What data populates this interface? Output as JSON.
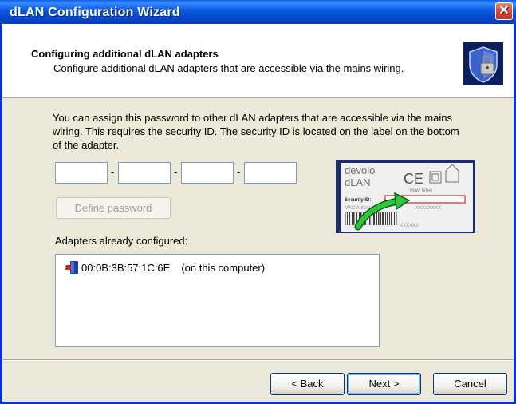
{
  "window": {
    "title": "dLAN Configuration Wizard",
    "close_glyph": "✕"
  },
  "header": {
    "title": "Configuring additional dLAN adapters",
    "subtitle": "Configure additional dLAN adapters that are accessible via the mains wiring.",
    "icon": "security-lock-icon"
  },
  "body": {
    "description": "You can assign this password to other dLAN adapters that are accessible via the mains wiring. This requires the security ID. The security ID is located on the label on the bottom of the adapter.",
    "password_fields": [
      "",
      "",
      "",
      ""
    ],
    "separator": "-",
    "define_button": "Define password",
    "adapters_label": "Adapters already configured:",
    "adapters": [
      {
        "mac": "00:0B:3B:57:1C:6E",
        "note": "(on this computer)"
      }
    ]
  },
  "label_image": {
    "brand": "devolo",
    "product": "dLAN",
    "ce": "CE",
    "voltage": "230V  50Hz",
    "security_id_label": "Security ID:",
    "mac_label": "MAC Adresse",
    "mac_value": "XXXXXXXX",
    "extra": "XXXXXX"
  },
  "footer": {
    "back": "< Back",
    "next": "Next >",
    "cancel": "Cancel"
  },
  "colors": {
    "titlebar": "#0A5FE8",
    "face": "#ECE9D8",
    "arrow": "#1E9E2E",
    "highlight_box": "#E02020"
  }
}
